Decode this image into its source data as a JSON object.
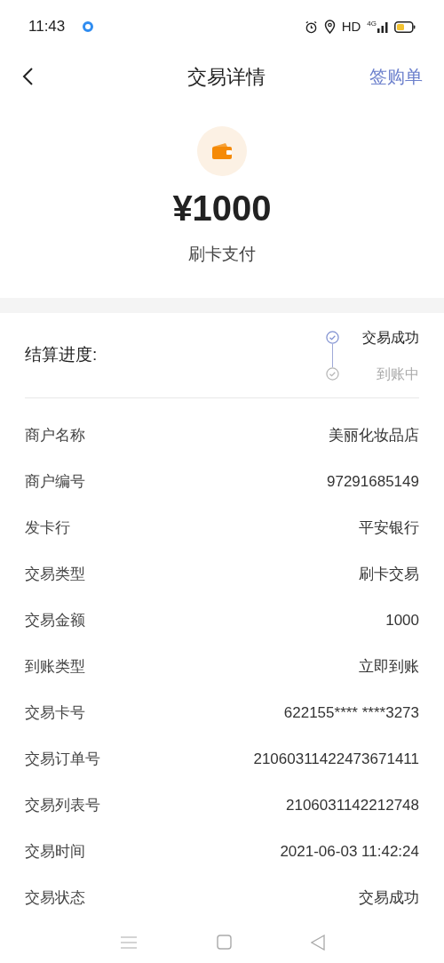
{
  "status_bar": {
    "time": "11:43",
    "hd": "HD",
    "network": "4G"
  },
  "header": {
    "title": "交易详情",
    "action": "签购单"
  },
  "summary": {
    "amount": "¥1000",
    "method": "刷卡支付"
  },
  "progress": {
    "label": "结算进度:",
    "steps": [
      {
        "label": "交易成功",
        "active": true
      },
      {
        "label": "到账中",
        "active": false
      }
    ]
  },
  "details": [
    {
      "label": "商户名称",
      "value": "美丽化妆品店"
    },
    {
      "label": "商户编号",
      "value": "97291685149"
    },
    {
      "label": "发卡行",
      "value": "平安银行"
    },
    {
      "label": "交易类型",
      "value": "刷卡交易"
    },
    {
      "label": "交易金额",
      "value": "1000"
    },
    {
      "label": "到账类型",
      "value": "立即到账"
    },
    {
      "label": "交易卡号",
      "value": "622155**** ****3273"
    },
    {
      "label": "交易订单号",
      "value": "21060311422473671411"
    },
    {
      "label": "交易列表号",
      "value": "2106031142212748"
    },
    {
      "label": "交易时间",
      "value": "2021-06-03 11:42:24"
    },
    {
      "label": "交易状态",
      "value": "交易成功"
    }
  ]
}
